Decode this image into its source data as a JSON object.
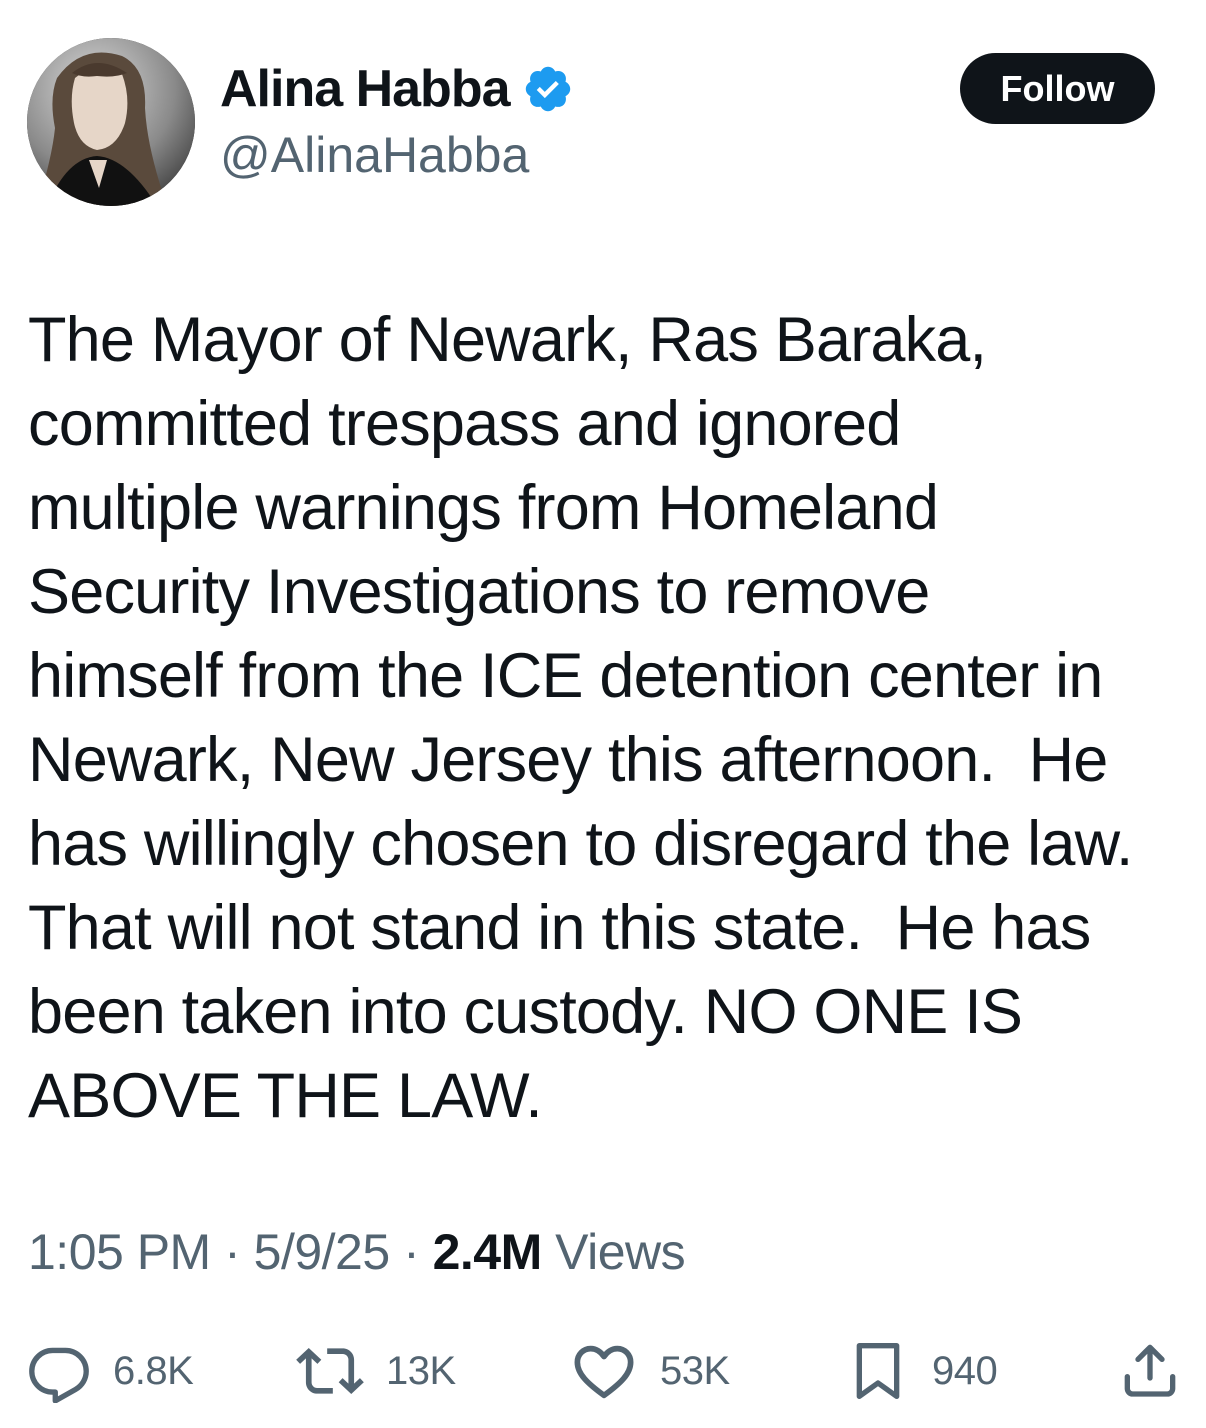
{
  "author": {
    "display_name": "Alina Habba",
    "handle": "@AlinaHabba",
    "verified": true,
    "avatar_icon": "profile-photo",
    "verified_icon": "verified-badge-icon"
  },
  "follow_button": {
    "label": "Follow"
  },
  "tweet": {
    "text": "The Mayor of Newark, Ras Baraka,\ncommitted trespass and ignored\nmultiple warnings from Homeland\nSecurity Investigations to remove\nhimself from the ICE detention center in\nNewark, New Jersey this afternoon.  He\nhas willingly chosen to disregard the law.\nThat will not stand in this state.  He has\nbeen taken into custody. NO ONE IS\nABOVE THE LAW."
  },
  "meta": {
    "time": "1:05 PM",
    "separator": " · ",
    "date": "5/9/25",
    "views_count": "2.4M",
    "views_label": " Views"
  },
  "actions": {
    "replies": {
      "icon": "reply-icon",
      "count": "6.8K"
    },
    "reposts": {
      "icon": "repost-icon",
      "count": "13K"
    },
    "likes": {
      "icon": "heart-icon",
      "count": "53K"
    },
    "bookmarks": {
      "icon": "bookmark-icon",
      "count": "940"
    },
    "share": {
      "icon": "share-icon"
    }
  },
  "colors": {
    "text_primary": "#0f1419",
    "text_secondary": "#536471",
    "verified_blue": "#1d9bf0",
    "button_bg": "#0f1419",
    "button_text": "#ffffff"
  }
}
